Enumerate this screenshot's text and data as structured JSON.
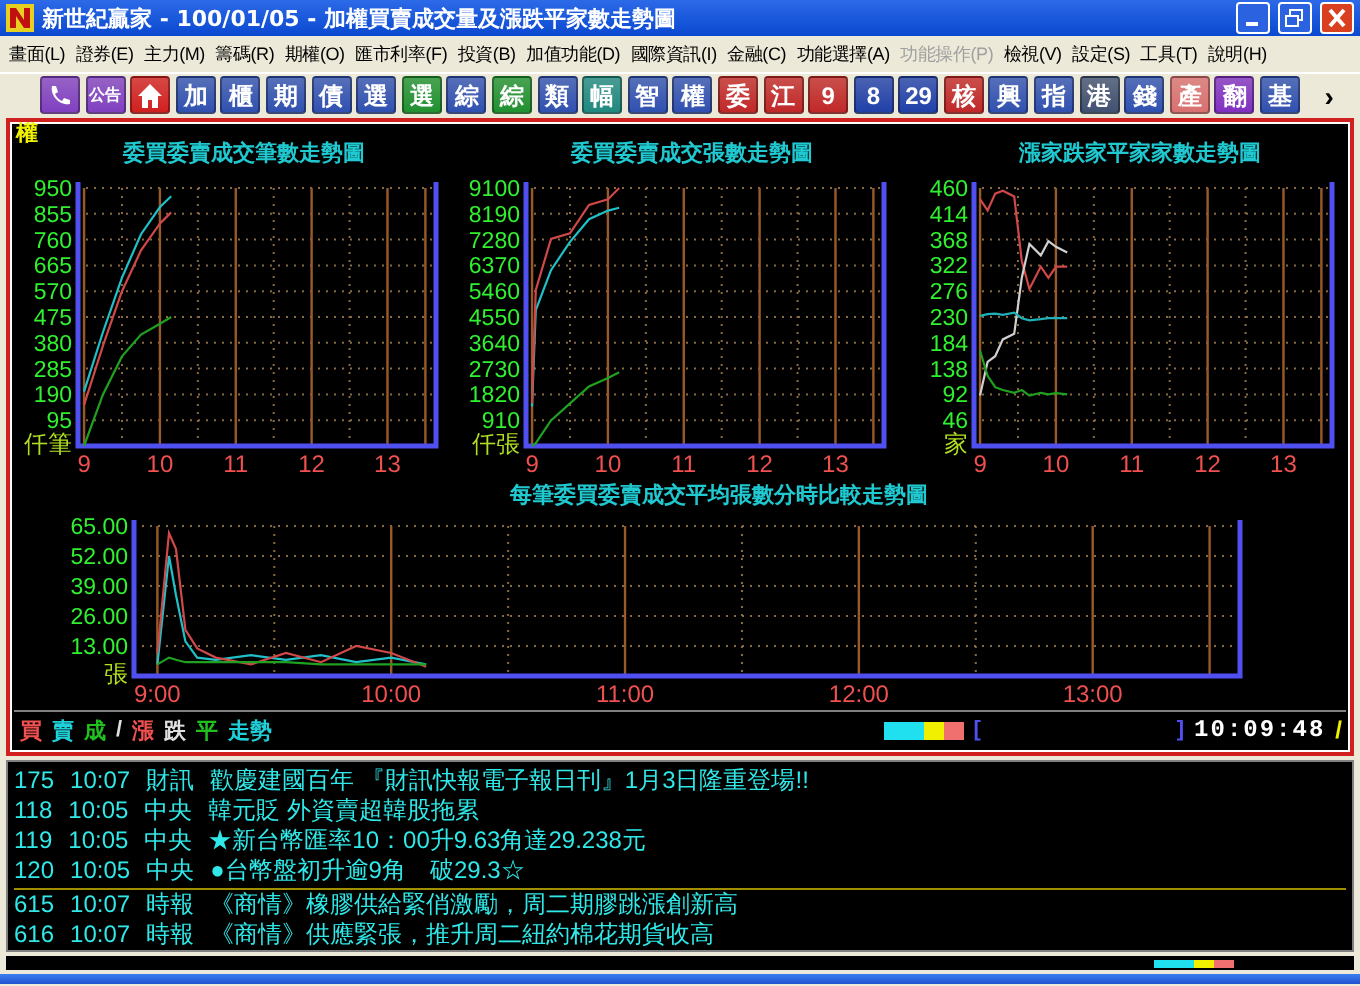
{
  "window": {
    "title": "新世紀贏家 - 100/01/05 - 加權買賣成交量及漲跌平家數走勢圖"
  },
  "menu": [
    {
      "label": "畫面(L)",
      "disabled": false
    },
    {
      "label": "證券(E)",
      "disabled": false
    },
    {
      "label": "主力(M)",
      "disabled": false
    },
    {
      "label": "籌碼(R)",
      "disabled": false
    },
    {
      "label": "期權(O)",
      "disabled": false
    },
    {
      "label": "匯市利率(F)",
      "disabled": false
    },
    {
      "label": "投資(B)",
      "disabled": false
    },
    {
      "label": "加值功能(D)",
      "disabled": false
    },
    {
      "label": "國際資訊(I)",
      "disabled": false
    },
    {
      "label": "金融(C)",
      "disabled": false
    },
    {
      "label": "功能選擇(A)",
      "disabled": false
    },
    {
      "label": "功能操作(P)",
      "disabled": true
    },
    {
      "label": "檢視(V)",
      "disabled": false
    },
    {
      "label": "設定(S)",
      "disabled": false
    },
    {
      "label": "工具(T)",
      "disabled": false
    },
    {
      "label": "說明(H)",
      "disabled": false
    }
  ],
  "toolbar": [
    {
      "kind": "phone",
      "color": "#8040c0"
    },
    {
      "kind": "text",
      "label": "公告",
      "color": "#8040c0"
    },
    {
      "kind": "home",
      "color": "#d02020"
    },
    {
      "kind": "text",
      "label": "加",
      "color": "#3050b0"
    },
    {
      "kind": "text",
      "label": "櫃",
      "color": "#3050b0"
    },
    {
      "kind": "text",
      "label": "期",
      "color": "#3050b0"
    },
    {
      "kind": "text",
      "label": "債",
      "color": "#3050b0"
    },
    {
      "kind": "text",
      "label": "選",
      "color": "#3050b0"
    },
    {
      "kind": "text",
      "label": "選",
      "color": "#209030"
    },
    {
      "kind": "text",
      "label": "綜",
      "color": "#3050b0"
    },
    {
      "kind": "text",
      "label": "綜",
      "color": "#209030"
    },
    {
      "kind": "text",
      "label": "類",
      "color": "#3050b0"
    },
    {
      "kind": "text",
      "label": "幅",
      "color": "#208880"
    },
    {
      "kind": "text",
      "label": "智",
      "color": "#3050b0"
    },
    {
      "kind": "text",
      "label": "權",
      "color": "#3050b0"
    },
    {
      "kind": "text",
      "label": "委",
      "color": "#c02828"
    },
    {
      "kind": "text",
      "label": "江",
      "color": "#c02828"
    },
    {
      "kind": "text",
      "label": "9",
      "color": "#c02828"
    },
    {
      "kind": "text",
      "label": "8",
      "color": "#2040a8"
    },
    {
      "kind": "text",
      "label": "29",
      "color": "#2040a8"
    },
    {
      "kind": "text",
      "label": "核",
      "color": "#c02828"
    },
    {
      "kind": "text",
      "label": "興",
      "color": "#3050b0"
    },
    {
      "kind": "text",
      "label": "指",
      "color": "#3050b0"
    },
    {
      "kind": "text",
      "label": "港",
      "color": "#405070"
    },
    {
      "kind": "text",
      "label": "錢",
      "color": "#3050b0"
    },
    {
      "kind": "text",
      "label": "產",
      "color": "#d87070"
    },
    {
      "kind": "text",
      "label": "翻",
      "color": "#8030c0"
    },
    {
      "kind": "text",
      "label": "基",
      "color": "#3050b0"
    },
    {
      "kind": "more",
      "label": "›"
    }
  ],
  "main": {
    "index_label": "權",
    "charts": [
      {
        "chart_data": {
          "type": "line",
          "title": "委買委賣成交筆數走勢圖",
          "grid": true,
          "ref_lines": [
            {
              "axis": "x",
              "value": 13.5
            }
          ],
          "x": [
            9,
            9.25,
            9.5,
            9.75,
            10,
            10.15
          ],
          "xlim": [
            8.92,
            13.64
          ],
          "ylim": [
            0,
            950
          ],
          "xticks": [
            9,
            10,
            11,
            12,
            13
          ],
          "yticks": [
            {
              "value": 0,
              "label": "仟筆"
            },
            95,
            190,
            285,
            380,
            475,
            570,
            665,
            760,
            855,
            950
          ],
          "series": [
            {
              "color": "#20c0c8",
              "values": [
                200,
                420,
                620,
                780,
                880,
                920
              ]
            },
            {
              "color": "#d04848",
              "values": [
                150,
                370,
                570,
                720,
                820,
                860
              ]
            },
            {
              "color": "#20a020",
              "values": [
                0,
                190,
                330,
                410,
                450,
                475
              ]
            }
          ]
        }
      },
      {
        "chart_data": {
          "type": "line",
          "title": "委買委賣成交張數走勢圖",
          "grid": true,
          "ref_lines": [
            {
              "axis": "x",
              "value": 13.5
            }
          ],
          "x": [
            9,
            9.05,
            9.25,
            9.5,
            9.75,
            10,
            10.15
          ],
          "xlim": [
            8.92,
            13.64
          ],
          "ylim": [
            0,
            9100
          ],
          "xticks": [
            9,
            10,
            11,
            12,
            13
          ],
          "yticks": [
            {
              "value": 0,
              "label": "仟張"
            },
            910,
            1820,
            2730,
            3640,
            4550,
            5460,
            6370,
            7280,
            8190,
            9100
          ],
          "series": [
            {
              "color": "#20c0c8",
              "values": [
                1400,
                4800,
                6200,
                7200,
                8000,
                8300,
                8400
              ]
            },
            {
              "color": "#d04848",
              "values": [
                1500,
                5500,
                7300,
                7500,
                8500,
                8700,
                9100
              ]
            },
            {
              "color": "#20a020",
              "values": [
                0,
                100,
                900,
                1500,
                2100,
                2400,
                2600
              ]
            }
          ]
        }
      },
      {
        "chart_data": {
          "type": "line",
          "title": "漲家跌家平家家數走勢圖",
          "grid": true,
          "ref_lines": [
            {
              "axis": "x",
              "value": 13.5
            }
          ],
          "x": [
            9,
            9.1,
            9.2,
            9.3,
            9.45,
            9.55,
            9.65,
            9.8,
            9.9,
            10,
            10.15
          ],
          "xlim": [
            8.92,
            13.64
          ],
          "ylim": [
            0,
            460
          ],
          "xticks": [
            9,
            10,
            11,
            12,
            13
          ],
          "yticks": [
            {
              "value": 0,
              "label": "家"
            },
            46,
            92,
            138,
            184,
            230,
            276,
            322,
            368,
            414,
            460
          ],
          "series": [
            {
              "color": "#d04848",
              "values": [
                440,
                420,
                450,
                455,
                445,
                330,
                280,
                320,
                300,
                320,
                320
              ]
            },
            {
              "color": "#d0d0d0",
              "values": [
                90,
                150,
                160,
                190,
                200,
                300,
                360,
                340,
                365,
                355,
                345
              ]
            },
            {
              "color": "#20b0b8",
              "values": [
                232,
                235,
                236,
                234,
                238,
                228,
                224,
                226,
                228,
                228,
                228
              ]
            },
            {
              "color": "#20a020",
              "values": [
                170,
                125,
                105,
                100,
                95,
                100,
                90,
                95,
                92,
                94,
                92
              ]
            }
          ]
        }
      },
      {
        "chart_data": {
          "type": "line",
          "title": "每筆委買委賣成交平均張數分時比較走勢圖",
          "grid": true,
          "ref_lines": [
            {
              "axis": "x",
              "value": 13.5
            }
          ],
          "x": [
            9,
            9.05,
            9.08,
            9.12,
            9.17,
            9.25,
            9.4,
            9.55,
            9.7,
            9.85,
            10,
            10.15
          ],
          "xlim": [
            8.9,
            13.63
          ],
          "ylim": [
            0,
            65
          ],
          "xticks": [
            {
              "value": 9,
              "label": "9:00"
            },
            {
              "value": 10,
              "label": "10:00"
            },
            {
              "value": 11,
              "label": "11:00"
            },
            {
              "value": 12,
              "label": "12:00"
            },
            {
              "value": 13,
              "label": "13:00"
            }
          ],
          "yticks": [
            {
              "value": 0,
              "label": "張"
            },
            {
              "value": 13,
              "label": "13.00"
            },
            {
              "value": 26,
              "label": "26.00"
            },
            {
              "value": 39,
              "label": "39.00"
            },
            {
              "value": 52,
              "label": "52.00"
            },
            {
              "value": 65,
              "label": "65.00"
            }
          ],
          "series": [
            {
              "color": "#20c0c8",
              "values": [
                5,
                52,
                35,
                15,
                8,
                7,
                9,
                7,
                9,
                6,
                8,
                5
              ]
            },
            {
              "color": "#d04848",
              "values": [
                10,
                62,
                55,
                20,
                12,
                8,
                5,
                10,
                6,
                13,
                10,
                4
              ]
            },
            {
              "color": "#20a020",
              "values": [
                5,
                8,
                7,
                6,
                6,
                6,
                6,
                6,
                5,
                5,
                5,
                5
              ]
            }
          ]
        }
      }
    ],
    "legend": [
      {
        "text": "買",
        "color": "#f05050"
      },
      {
        "text": "賣",
        "color": "#20d0d8"
      },
      {
        "text": "成",
        "color": "#20c020"
      },
      {
        "text": "/",
        "color": "#e0e0e0"
      },
      {
        "text": "漲",
        "color": "#f05050"
      },
      {
        "text": "跌",
        "color": "#e0e0e0"
      },
      {
        "text": "平",
        "color": "#20c020"
      },
      {
        "text": "走勢",
        "color": "#20d0d8"
      }
    ],
    "bracket_open": "[",
    "bracket_close": "]",
    "time": "10:09:48",
    "spinner": "/"
  },
  "news": [
    [
      {
        "id": "175",
        "time": "10:07",
        "source": "財訊",
        "headline": "歡慶建國百年 『財訊快報電子報日刊』1月3日隆重登場!!"
      },
      {
        "id": "118",
        "time": "10:05",
        "source": "中央",
        "headline": "韓元貶 外資賣超韓股拖累"
      },
      {
        "id": "119",
        "time": "10:05",
        "source": "中央",
        "headline": "★新台幣匯率10：00升9.63角達29.238元"
      },
      {
        "id": "120",
        "time": "10:05",
        "source": "中央",
        "headline": "●台幣盤初升逾9角　破29.3☆"
      }
    ],
    [
      {
        "id": "615",
        "time": "10:07",
        "source": "時報",
        "headline": "《商情》橡膠供給緊俏激勵，周二期膠跳漲創新高"
      },
      {
        "id": "616",
        "time": "10:07",
        "source": "時報",
        "headline": "《商情》供應緊張，推升周二紐約棉花期貨收高"
      }
    ]
  ]
}
